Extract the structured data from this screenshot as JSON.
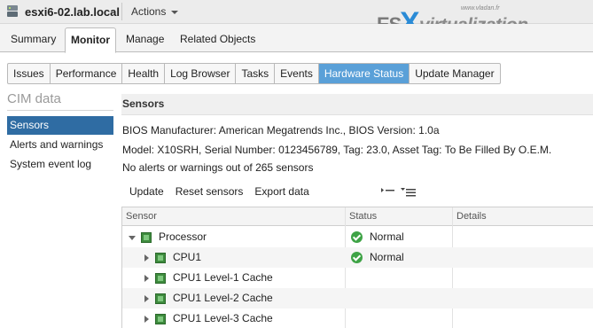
{
  "header": {
    "host_title": "esxi6-02.lab.local",
    "actions_label": "Actions"
  },
  "logo": {
    "small_text": "www.vladan.fr",
    "es": "ES",
    "x": "X",
    "virt": "virtualization"
  },
  "main_tabs": [
    "Summary",
    "Monitor",
    "Manage",
    "Related Objects"
  ],
  "main_tab_active": "Monitor",
  "sub_tabs": [
    "Issues",
    "Performance",
    "Health",
    "Log Browser",
    "Tasks",
    "Events",
    "Hardware Status",
    "Update Manager"
  ],
  "sub_tab_active": "Hardware Status",
  "left_nav": {
    "title": "CIM data",
    "items": [
      "Sensors",
      "Alerts and warnings",
      "System event log"
    ],
    "active": "Sensors"
  },
  "sensors": {
    "title": "Sensors",
    "line1": "BIOS Manufacturer:  American Megatrends Inc.,  BIOS Version:  1.0a",
    "line2": "Model:  X10SRH,  Serial Number:  0123456789,  Tag:  23.0,  Asset Tag:  To Be Filled By O.E.M.",
    "line3": "No alerts or warnings out of 265 sensors",
    "toolbar": {
      "update": "Update",
      "reset": "Reset sensors",
      "export": "Export data"
    },
    "columns": [
      "Sensor",
      "Status",
      "Details"
    ],
    "rows": [
      {
        "name": "Processor",
        "status": "Normal",
        "expanded": true
      },
      {
        "name": "CPU1",
        "status": "Normal",
        "expanded": false
      },
      {
        "name": "CPU1 Level-1 Cache",
        "status": "",
        "expanded": false
      },
      {
        "name": "CPU1 Level-2 Cache",
        "status": "",
        "expanded": false
      },
      {
        "name": "CPU1 Level-3 Cache",
        "status": "",
        "expanded": false
      }
    ]
  },
  "colors": {
    "active_subtab": "#5aa0d8",
    "active_nav": "#2f6ca3",
    "status_ok": "#3ea346"
  }
}
